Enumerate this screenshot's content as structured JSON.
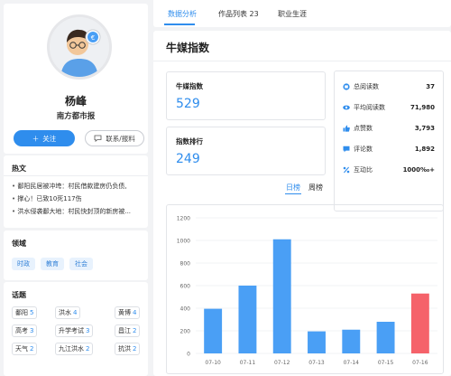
{
  "profile": {
    "name": "杨峰",
    "org": "南方都市报",
    "follow_label": "关注",
    "contact_label": "联系/报料",
    "avatar_badge": "€"
  },
  "hot": {
    "title": "热文",
    "items": [
      "鄱阳民居被冲垮：村民借款建房仍负债,",
      "撑心！已致10死117伤",
      "洪水侵袭鄱大地：村民快封顶的新房被..."
    ]
  },
  "areas": {
    "title": "领域",
    "tags": [
      "时政",
      "教育",
      "社会"
    ]
  },
  "topics": {
    "title": "话题",
    "items": [
      {
        "name": "鄱阳",
        "count": "5"
      },
      {
        "name": "洪水",
        "count": "4"
      },
      {
        "name": "黄博",
        "count": "4"
      },
      {
        "name": "高考",
        "count": "3"
      },
      {
        "name": "升学考试",
        "count": "3"
      },
      {
        "name": "昌江",
        "count": "2"
      },
      {
        "name": "天气",
        "count": "2"
      },
      {
        "name": "九江洪水",
        "count": "2"
      },
      {
        "name": "抗洪",
        "count": "2"
      }
    ]
  },
  "tabs": {
    "items": [
      "数据分析",
      "作品列表 23",
      "职业生涯"
    ],
    "active": "数据分析"
  },
  "main": {
    "title": "牛媒指数",
    "index_label": "牛媒指数",
    "index_value": "529",
    "rank_label": "指数排行",
    "rank_value": "249",
    "metrics": [
      {
        "icon": "book-icon",
        "label": "总阅读数",
        "value": "37"
      },
      {
        "icon": "eye-icon",
        "label": "平均阅读数",
        "value": "71,980"
      },
      {
        "icon": "thumbs-up-icon",
        "label": "点赞数",
        "value": "3,793"
      },
      {
        "icon": "comment-icon",
        "label": "评论数",
        "value": "1,892"
      },
      {
        "icon": "ratio-icon",
        "label": "互动比",
        "value": "1000‰+"
      }
    ],
    "subtabs": [
      "日榜",
      "周榜"
    ]
  },
  "colors": {
    "accent": "#2f8ded",
    "bar": "#4a9ff5",
    "bar_highlight": "#f5626a"
  },
  "chart_data": {
    "type": "bar",
    "categories": [
      "07-10",
      "07-11",
      "07-12",
      "07-13",
      "07-14",
      "07-15",
      "07-16"
    ],
    "values": [
      395,
      600,
      1010,
      195,
      210,
      280,
      530
    ],
    "highlight_index": 6,
    "ylim": [
      0,
      1200
    ],
    "yticks": [
      0,
      200,
      400,
      600,
      800,
      1000,
      1200
    ],
    "grid": true
  }
}
